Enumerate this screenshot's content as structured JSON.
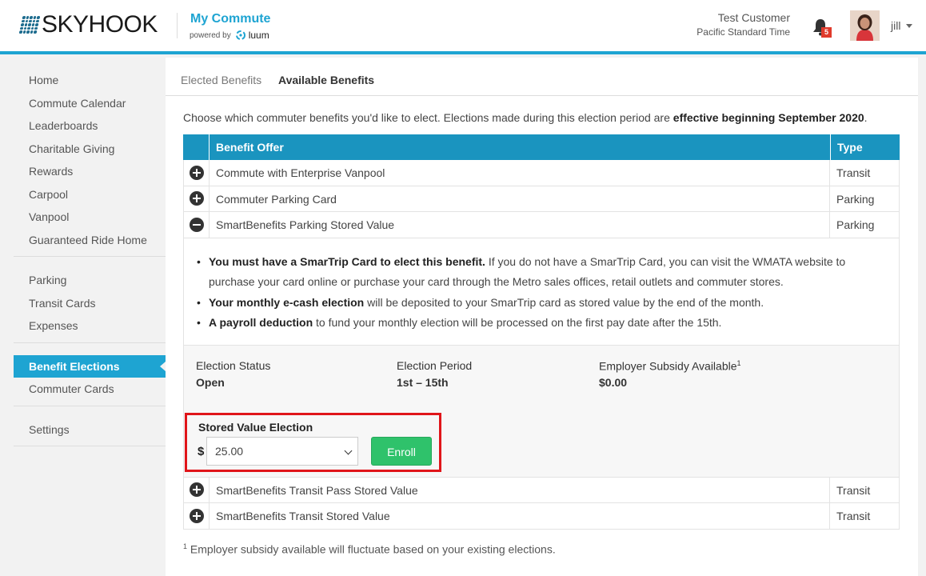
{
  "header": {
    "logo_text": "SKYHOOK",
    "app_title": "My Commute",
    "powered_by": "powered by",
    "powered_brand": "luum",
    "user_name": "Test Customer",
    "user_timezone": "Pacific Standard Time",
    "notification_count": "5",
    "username": "jill"
  },
  "sidebar": {
    "groups": [
      {
        "items": [
          "Home",
          "Commute Calendar",
          "Leaderboards",
          "Charitable Giving",
          "Rewards",
          "Carpool",
          "Vanpool",
          "Guaranteed Ride Home"
        ]
      },
      {
        "items": [
          "Parking",
          "Transit Cards",
          "Expenses"
        ]
      },
      {
        "items": [
          "Benefit Elections",
          "Commuter Cards"
        ]
      },
      {
        "items": [
          "Settings"
        ]
      }
    ],
    "active_item": "Benefit Elections"
  },
  "tabs": [
    "Elected Benefits",
    "Available Benefits"
  ],
  "active_tab": "Available Benefits",
  "intro": {
    "text": "Choose which commuter benefits you'd like to elect. Elections made during this election period are ",
    "bold": "effective beginning September 2020",
    "end": "."
  },
  "table": {
    "headers": {
      "offer": "Benefit Offer",
      "type": "Type"
    },
    "rows_before": [
      {
        "offer": "Commute with Enterprise Vanpool",
        "type": "Transit",
        "expanded": false
      },
      {
        "offer": "Commuter Parking Card",
        "type": "Parking",
        "expanded": false
      },
      {
        "offer": "SmartBenefits Parking Stored Value",
        "type": "Parking",
        "expanded": true
      }
    ],
    "rows_after": [
      {
        "offer": "SmartBenefits Transit Pass Stored Value",
        "type": "Transit",
        "expanded": false
      },
      {
        "offer": "SmartBenefits Transit Stored Value",
        "type": "Transit",
        "expanded": false
      }
    ]
  },
  "details": {
    "bullet1_bold": "You must have a SmarTrip Card to elect this benefit.",
    "bullet1_text": " If you do not have a SmarTrip Card, you can visit the WMATA website to",
    "bullet1_cont": "purchase your card online or purchase your card through the Metro sales offices, retail outlets and commuter stores.",
    "bullet2_bold": "Your monthly e-cash election",
    "bullet2_text": " will be deposited to your SmarTrip card as stored value by the end of the month.",
    "bullet3_bold": "A payroll deduction",
    "bullet3_text": " to fund your monthly election will be processed on the first pay date after the 15th.",
    "election_status_label": "Election Status",
    "election_status_value": "Open",
    "election_period_label": "Election Period",
    "election_period_value": "1st – 15th",
    "subsidy_label": "Employer Subsidy Available",
    "subsidy_sup": "1",
    "subsidy_value": "$0.00",
    "stored_value_title": "Stored Value Election",
    "currency_symbol": "$",
    "stored_value_selected": "25.00",
    "enroll_label": "Enroll"
  },
  "footnote": {
    "sup": "1",
    "text": " Employer subsidy available will fluctuate based on your existing elections."
  },
  "colors": {
    "accent": "#1ea4d2",
    "table_header": "#1a94bf",
    "enroll": "#2fc26b",
    "highlight_box": "#e0151a",
    "badge": "#e03a2b"
  }
}
